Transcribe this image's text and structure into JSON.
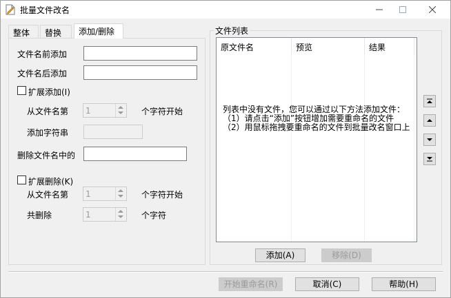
{
  "window": {
    "title": "批量文件改名"
  },
  "tabs": [
    {
      "label": "整体"
    },
    {
      "label": "替换"
    },
    {
      "label": "添加/删除"
    }
  ],
  "add_delete": {
    "prefix_label": "文件名前添加",
    "prefix_value": "",
    "suffix_label": "文件名后添加",
    "suffix_value": "",
    "ext_add_label": "扩展添加(I)",
    "from_pos_label": "从文件名第",
    "from_pos_value": "1",
    "from_pos_unit": "个字符开始",
    "insert_str_label": "添加字符串",
    "insert_str_value": "",
    "delete_in_label": "删除文件名中的",
    "delete_in_value": "",
    "ext_delete_label": "扩展删除(K)",
    "del_from_label": "从文件名第",
    "del_from_value": "1",
    "del_from_unit": "个字符开始",
    "del_count_label": "共删除",
    "del_count_value": "1",
    "del_count_unit": "个字符"
  },
  "file_list": {
    "group_title": "文件列表",
    "columns": [
      "原文件名",
      "预览",
      "结果"
    ],
    "empty_line1": "列表中没有文件，您可以通过以下方法添加文件：",
    "empty_line2": "（1）请点击“添加”按钮增加需要重命名的文件",
    "empty_line3": "（2）用鼠标拖拽要重命名的文件到批量改名窗口上",
    "add_label": "添加(A)",
    "remove_label": "移除(D)"
  },
  "footer": {
    "start_label": "开始重命名(R)",
    "cancel_label": "取消(C)",
    "help_label": "帮助(H)"
  }
}
